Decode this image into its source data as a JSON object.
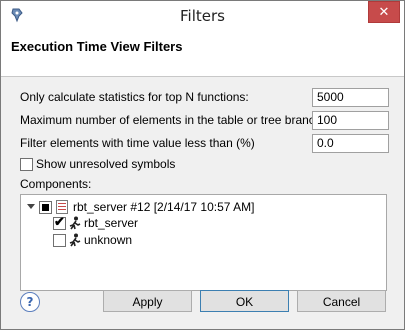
{
  "window": {
    "title": "Filters",
    "close_symbol": "✕"
  },
  "header": {
    "title": "Execution Time View Filters"
  },
  "fields": [
    {
      "label": "Only calculate statistics for top N functions:",
      "value": "5000"
    },
    {
      "label": "Maximum number of elements in the table or tree branch:",
      "value": "100"
    },
    {
      "label": "Filter elements with time value less than (%)",
      "value": "0.0"
    }
  ],
  "unresolved": {
    "label": "Show unresolved symbols",
    "checked": false
  },
  "components": {
    "label": "Components:",
    "root": {
      "label": "rbt_server #12 [2/14/17 10:57 AM]",
      "expanded": true,
      "state": "partial"
    },
    "children": [
      {
        "label": "rbt_server",
        "checked": true
      },
      {
        "label": "unknown",
        "checked": false
      }
    ]
  },
  "buttons": {
    "help": "?",
    "apply": "Apply",
    "ok": "OK",
    "cancel": "Cancel"
  },
  "colors": {
    "close_button": "#c74b4b",
    "default_button_border": "#3c7fb1"
  }
}
